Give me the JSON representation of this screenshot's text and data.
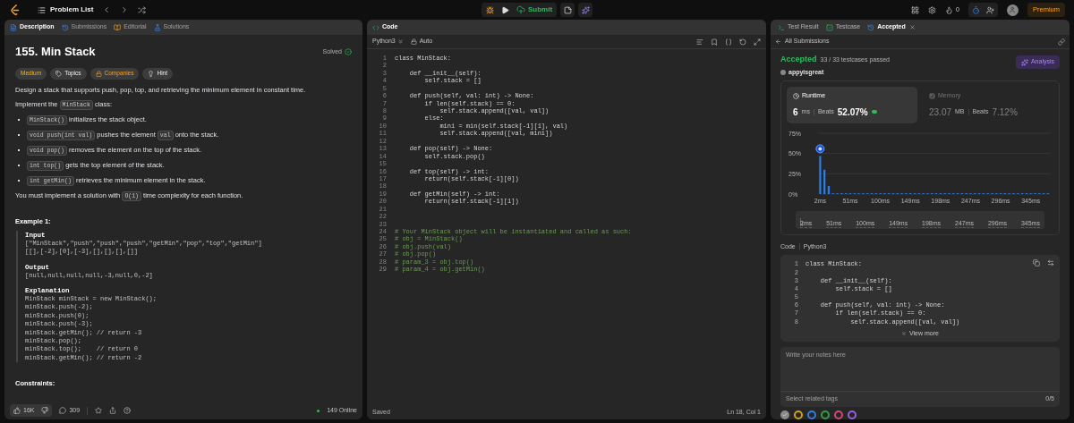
{
  "top_bar": {
    "problem_list": "Problem List",
    "submit": "Submit",
    "streak": "0",
    "premium": "Premium"
  },
  "left_tabs": [
    {
      "label": "Description",
      "kind": "description",
      "selected": true
    },
    {
      "label": "Submissions",
      "kind": "submissions",
      "selected": false
    },
    {
      "label": "Editorial",
      "kind": "editorial",
      "selected": false
    },
    {
      "label": "Solutions",
      "kind": "solutions",
      "selected": false
    }
  ],
  "problem": {
    "title": "155. Min Stack",
    "status": "Solved",
    "tags": [
      {
        "label": "Medium",
        "kind": "difficulty"
      },
      {
        "label": "Topics",
        "kind": "topic"
      },
      {
        "label": "Companies",
        "kind": "locked"
      },
      {
        "label": "Hint",
        "kind": "hint"
      }
    ],
    "description": [
      {
        "kind": "para",
        "parts": [
          {
            "kind": "text",
            "text": "Design a stack that supports push, pop, top, and retrieving the minimum element in constant time."
          }
        ]
      },
      {
        "kind": "para",
        "parts": [
          {
            "kind": "text",
            "text": "Implement the "
          },
          {
            "kind": "code",
            "text": "MinStack"
          },
          {
            "kind": "text",
            "text": " class:"
          }
        ]
      },
      {
        "kind": "bullet",
        "parts": [
          {
            "kind": "code",
            "text": "MinStack()"
          },
          {
            "kind": "text",
            "text": " initializes the stack object."
          }
        ]
      },
      {
        "kind": "bullet",
        "parts": [
          {
            "kind": "code",
            "text": "void push(int val)"
          },
          {
            "kind": "text",
            "text": " pushes the element "
          },
          {
            "kind": "code",
            "text": "val"
          },
          {
            "kind": "text",
            "text": " onto the stack."
          }
        ]
      },
      {
        "kind": "bullet",
        "parts": [
          {
            "kind": "code",
            "text": "void pop()"
          },
          {
            "kind": "text",
            "text": " removes the element on the top of the stack."
          }
        ]
      },
      {
        "kind": "bullet",
        "parts": [
          {
            "kind": "code",
            "text": "int top()"
          },
          {
            "kind": "text",
            "text": " gets the top element of the stack."
          }
        ]
      },
      {
        "kind": "bullet",
        "parts": [
          {
            "kind": "code",
            "text": "int getMin()"
          },
          {
            "kind": "text",
            "text": " retrieves the minimum element in the stack."
          }
        ]
      },
      {
        "kind": "para",
        "parts": [
          {
            "kind": "text",
            "text": "You must implement a solution with "
          },
          {
            "kind": "code",
            "text": "O(1)"
          },
          {
            "kind": "text",
            "text": " time complexity for each function."
          }
        ]
      }
    ],
    "example": {
      "title": "Example 1:",
      "sections": [
        {
          "label": "Input",
          "lines": [
            "[\"MinStack\",\"push\",\"push\",\"push\",\"getMin\",\"pop\",\"top\",\"getMin\"]",
            "[[],[-2],[0],[-3],[],[],[],[]]"
          ]
        },
        {
          "label": "Output",
          "lines": [
            "[null,null,null,null,-3,null,0,-2]"
          ]
        },
        {
          "label": "Explanation",
          "lines": [
            "MinStack minStack = new MinStack();",
            "minStack.push(-2);",
            "minStack.push(0);",
            "minStack.push(-3);",
            "minStack.getMin(); // return -3",
            "minStack.pop();",
            "minStack.top();    // return 0",
            "minStack.getMin(); // return -2"
          ]
        }
      ]
    },
    "constraints": "Constraints:"
  },
  "left_footer": {
    "likes": "16K",
    "comments": "309",
    "online": "149 Online"
  },
  "editor": {
    "title": "Code",
    "language": "Python3",
    "mode": "Auto",
    "status": "Saved",
    "position": "Ln 18, Col 1",
    "lines": [
      {
        "num": "1",
        "kind": "code",
        "text": "class MinStack:"
      },
      {
        "num": "2",
        "kind": "code"
      },
      {
        "num": "3",
        "kind": "code",
        "text": "    def __init__(self):"
      },
      {
        "num": "4",
        "kind": "code",
        "text": "        self.stack = []"
      },
      {
        "num": "5",
        "kind": "code"
      },
      {
        "num": "6",
        "kind": "code",
        "text": "    def push(self, val: int) -> None:"
      },
      {
        "num": "7",
        "kind": "code",
        "text": "        if len(self.stack) == 0:"
      },
      {
        "num": "8",
        "kind": "code",
        "text": "            self.stack.append([val, val])"
      },
      {
        "num": "9",
        "kind": "code",
        "text": "        else:"
      },
      {
        "num": "10",
        "kind": "code",
        "text": "            mini = min(self.stack[-1][1], val)"
      },
      {
        "num": "11",
        "kind": "code",
        "text": "            self.stack.append([val, mini])"
      },
      {
        "num": "12",
        "kind": "code"
      },
      {
        "num": "13",
        "kind": "code",
        "text": "    def pop(self) -> None:"
      },
      {
        "num": "14",
        "kind": "code",
        "text": "        self.stack.pop()"
      },
      {
        "num": "15",
        "kind": "code"
      },
      {
        "num": "16",
        "kind": "code",
        "text": "    def top(self) -> int:"
      },
      {
        "num": "17",
        "kind": "code",
        "text": "        return(self.stack[-1][0])"
      },
      {
        "num": "18",
        "kind": "code"
      },
      {
        "num": "19",
        "kind": "code",
        "text": "    def getMin(self) -> int:"
      },
      {
        "num": "20",
        "kind": "code",
        "text": "        return(self.stack[-1][1])"
      },
      {
        "num": "21",
        "kind": "code"
      },
      {
        "num": "22",
        "kind": "code"
      },
      {
        "num": "23",
        "kind": "code"
      },
      {
        "num": "24",
        "kind": "comment",
        "text": "# Your MinStack object will be instantiated and called as such:"
      },
      {
        "num": "25",
        "kind": "comment",
        "text": "# obj = MinStack()"
      },
      {
        "num": "26",
        "kind": "comment",
        "text": "# obj.push(val)"
      },
      {
        "num": "27",
        "kind": "comment",
        "text": "# obj.pop()"
      },
      {
        "num": "28",
        "kind": "comment",
        "text": "# param_3 = obj.top()"
      },
      {
        "num": "29",
        "kind": "comment",
        "text": "# param_4 = obj.getMin()"
      }
    ]
  },
  "right_tabs": [
    {
      "label": "Test Result",
      "kind": "result",
      "selected": false
    },
    {
      "label": "Testcase",
      "kind": "testcase",
      "selected": false
    },
    {
      "label": "Accepted",
      "kind": "submission",
      "selected": true
    }
  ],
  "submission": {
    "back": "All Submissions",
    "status": "Accepted",
    "passed": "33 / 33 testcases passed",
    "user": "appyisgreat",
    "analysis": "Analysis",
    "metrics": [
      {
        "kind": "runtime",
        "label": "Runtime",
        "value": "6",
        "unit": "ms",
        "beats_label": "Beats",
        "beats": "52.07%",
        "selected": true
      },
      {
        "kind": "memory",
        "label": "Memory",
        "value": "23.07",
        "unit": "MB",
        "beats_label": "Beats",
        "beats": "7.12%",
        "selected": false
      }
    ],
    "chart_data": {
      "type": "bar",
      "ylim": [
        0,
        75
      ],
      "xlim": [
        0,
        376
      ],
      "yticks": [
        {
          "value": 0,
          "label": "0%"
        },
        {
          "value": 25,
          "label": "25%"
        },
        {
          "value": 50,
          "label": "50%"
        },
        {
          "value": 75,
          "label": "75%"
        }
      ],
      "xticks": [
        {
          "value": 2,
          "label": "2ms"
        },
        {
          "value": 51,
          "label": "51ms"
        },
        {
          "value": 100,
          "label": "100ms"
        },
        {
          "value": 149,
          "label": "149ms"
        },
        {
          "value": 198,
          "label": "198ms"
        },
        {
          "value": 247,
          "label": "247ms"
        },
        {
          "value": 296,
          "label": "296ms"
        },
        {
          "value": 345,
          "label": "345ms"
        }
      ],
      "x": [
        2,
        9,
        16,
        23,
        30,
        37,
        44,
        51,
        58,
        65,
        72,
        79,
        86,
        93,
        100,
        107,
        114,
        121,
        128,
        135,
        142,
        149,
        156,
        163,
        170,
        177,
        184,
        191,
        198,
        205,
        212,
        219,
        226,
        233,
        240,
        247,
        254,
        261,
        268,
        275,
        282,
        289,
        296,
        303,
        310,
        317,
        324,
        331,
        338,
        345,
        352,
        359,
        366,
        373
      ],
      "series": [
        {
          "color": "#2b7de9",
          "values": [
            47,
            30,
            10,
            1,
            1,
            1,
            1,
            1,
            1,
            1,
            1,
            1,
            1,
            1,
            1,
            1,
            1,
            1,
            1,
            1,
            1,
            1,
            1,
            1,
            1,
            1,
            1,
            1,
            1,
            1,
            1,
            1,
            1,
            1,
            1,
            1,
            1,
            1,
            1,
            1,
            1,
            1,
            1,
            1,
            1,
            1,
            1,
            1,
            1,
            1,
            1,
            1,
            1,
            1
          ]
        }
      ]
    },
    "overview_labels": [
      "2ms",
      "51ms",
      "100ms",
      "149ms",
      "198ms",
      "247ms",
      "296ms",
      "345ms"
    ],
    "code_label": "Code",
    "code_language": "Python3",
    "snippet": [
      {
        "num": "1",
        "text": "class MinStack:"
      },
      {
        "num": "2"
      },
      {
        "num": "3",
        "text": "    def __init__(self):"
      },
      {
        "num": "4",
        "text": "        self.stack = []"
      },
      {
        "num": "5"
      },
      {
        "num": "6",
        "text": "    def push(self, val: int) -> None:"
      },
      {
        "num": "7",
        "text": "        if len(self.stack) == 0:"
      },
      {
        "num": "8",
        "text": "            self.stack.append([val, val])"
      }
    ],
    "view_more": "View more",
    "notes_placeholder": "Write your notes here",
    "tags_placeholder": "Select related tags",
    "tag_count": "0/5",
    "colors": [
      {
        "color": "#8a8a8a",
        "selected": true
      },
      {
        "color": "#d4a017",
        "selected": false
      },
      {
        "color": "#2f7ee0",
        "selected": false
      },
      {
        "color": "#2ea043",
        "selected": false
      },
      {
        "color": "#d6457a",
        "selected": false
      },
      {
        "color": "#9b5de5",
        "selected": false
      }
    ]
  }
}
